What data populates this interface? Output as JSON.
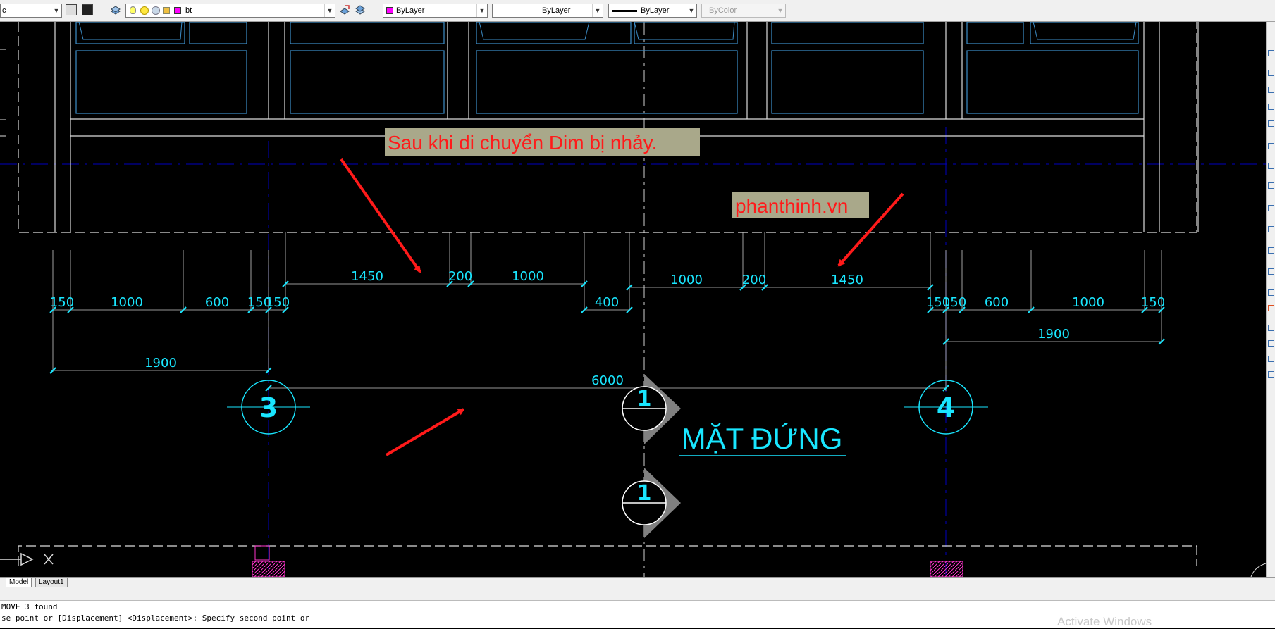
{
  "toolbar": {
    "workspace_value": "c",
    "layer_value": "bt",
    "color_value": "ByLayer",
    "linetype_value": "ByLayer",
    "lineweight_value": "ByLayer",
    "plotstyle_value": "ByColor",
    "layer_color": "#ff00ff"
  },
  "drawing": {
    "annotation_text": "Sau khi di chuyển Dim bị nhảy.",
    "website_text": "phanthinh.vn",
    "title_text": "MẶT ĐỨNG",
    "grid_labels": [
      "3",
      "4"
    ],
    "section_labels": [
      "1",
      "1"
    ],
    "dims": {
      "top_left": [
        "1450",
        "200",
        "1000"
      ],
      "top_right": [
        "1000",
        "200",
        "1450"
      ],
      "middle_left": [
        "150",
        "1000",
        "600",
        "150",
        "150"
      ],
      "middle_center": "400",
      "middle_right": [
        "150",
        "150",
        "600",
        "1000",
        "150"
      ],
      "bottom_left": "1900",
      "bottom_right": "1900",
      "overall": "6000"
    }
  },
  "tabs": [
    {
      "label": "Model"
    },
    {
      "label": "Layout1"
    }
  ],
  "command_line": [
    "MOVE 3 found",
    "se point or [Displacement] <Displacement>: Specify second point or"
  ],
  "watermark": "Activate Windows"
}
